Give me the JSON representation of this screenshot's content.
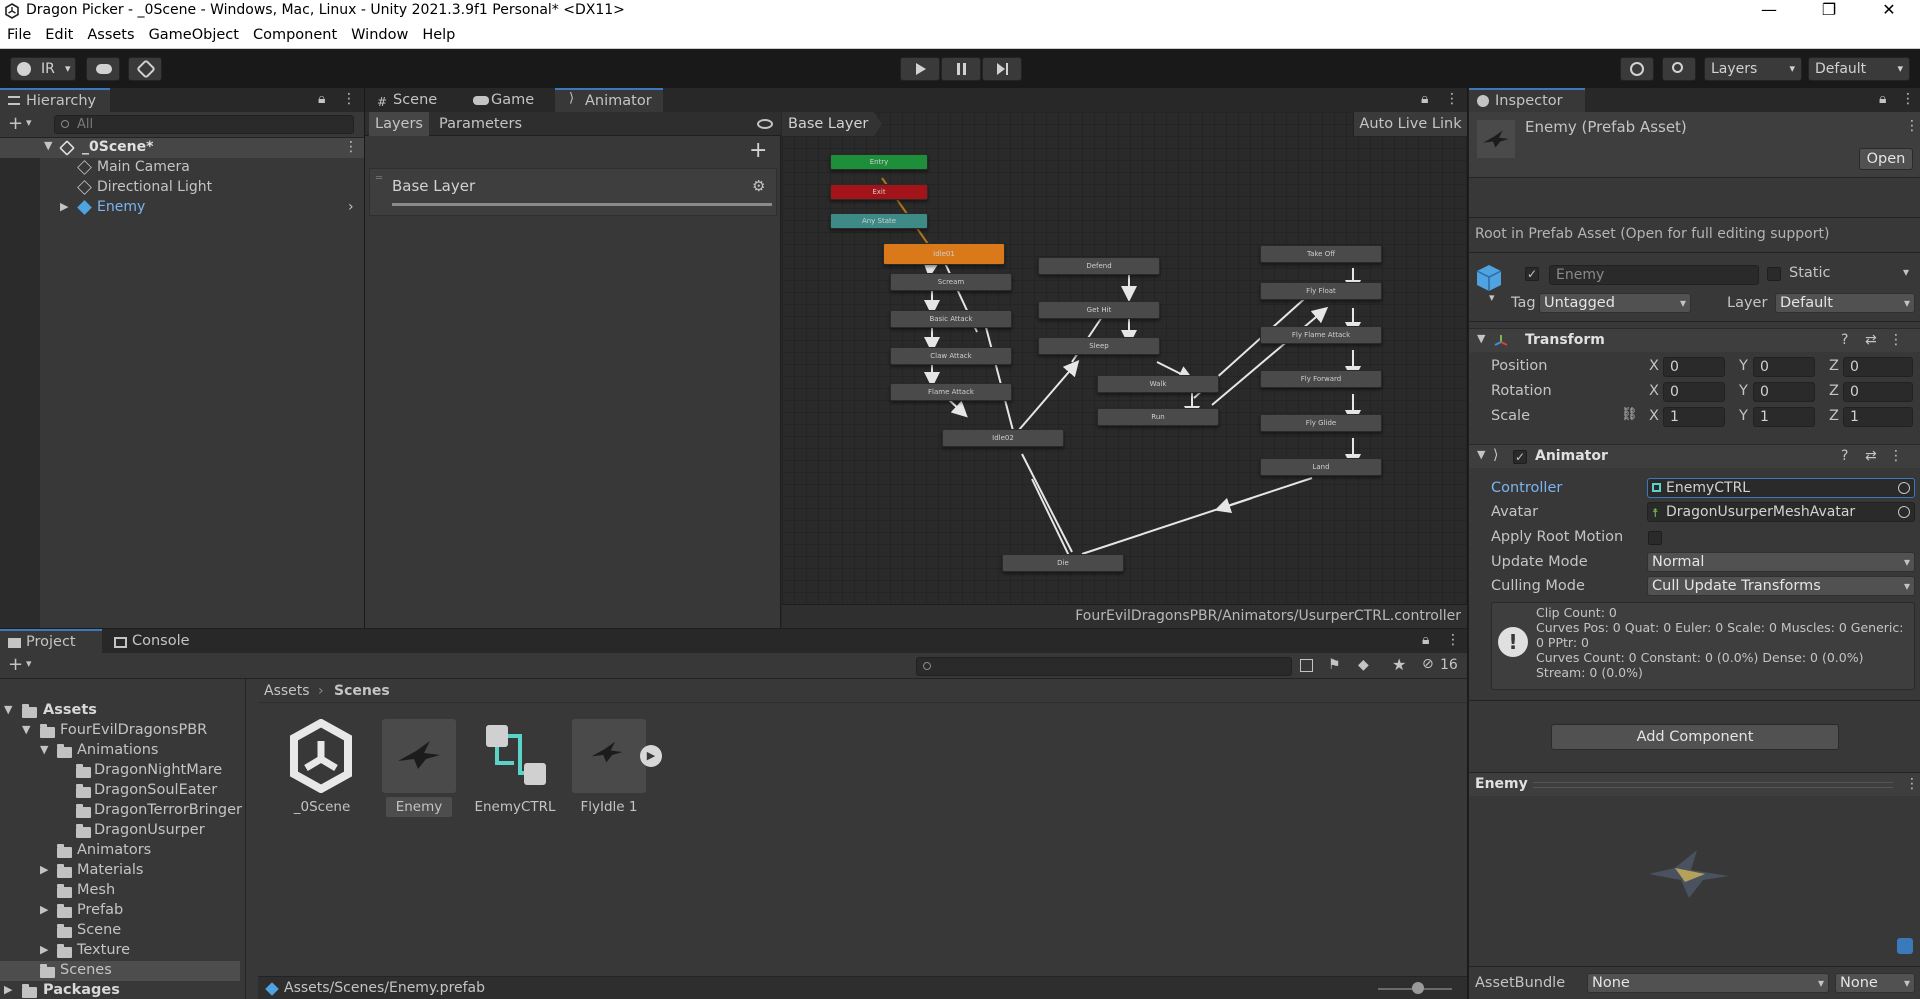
{
  "window": {
    "title": "Dragon Picker - _0Scene - Windows, Mac, Linux - Unity 2021.3.9f1 Personal* <DX11>",
    "minimize": "—",
    "maximize": "❐",
    "close": "✕"
  },
  "menu": [
    "File",
    "Edit",
    "Assets",
    "GameObject",
    "Component",
    "Window",
    "Help"
  ],
  "toolbar": {
    "account": "IR",
    "layers": "Layers",
    "layout": "Default"
  },
  "hierarchy": {
    "tab": "Hierarchy",
    "search_placeholder": "All",
    "scene": "_0Scene*",
    "items": [
      "Main Camera",
      "Directional Light",
      "Enemy"
    ]
  },
  "center_tabs": [
    "Scene",
    "Game",
    "Animator"
  ],
  "animator": {
    "subtabs": [
      "Layers",
      "Parameters"
    ],
    "layer": "Base Layer",
    "breadcrumb": "Base Layer",
    "auto_live_link": "Auto Live Link",
    "path": "FourEvilDragonsPBR/Animators/UsurperCTRL.controller",
    "states": {
      "entry": "Entry",
      "exit": "Exit",
      "any_state": "Any State",
      "idle01": "Idle01",
      "scream": "Scream",
      "basic_attack": "Basic Attack",
      "claw_attack": "Claw Attack",
      "flame_attack": "Flame Attack",
      "idle02": "Idle02",
      "defend": "Defend",
      "get_hit": "Get Hit",
      "sleep": "Sleep",
      "walk": "Walk",
      "run": "Run",
      "die": "Die",
      "take_off": "Take Off",
      "fly_float": "Fly Float",
      "fly_flame_attack": "Fly Flame Attack",
      "fly_forward": "Fly Forward",
      "fly_glide": "Fly Glide",
      "land": "Land"
    }
  },
  "project": {
    "tabs": [
      "Project",
      "Console"
    ],
    "tree": {
      "assets": "Assets",
      "fourevil": "FourEvilDragonsPBR",
      "animations": "Animations",
      "anim_children": [
        "DragonNightMare",
        "DragonSoulEater",
        "DragonTerrorBringer",
        "DragonUsurper"
      ],
      "others": [
        "Animators",
        "Materials",
        "Mesh",
        "Prefab",
        "Scene",
        "Texture"
      ],
      "scenes": "Scenes",
      "packages": "Packages"
    },
    "breadcrumb": [
      "Assets",
      "Scenes"
    ],
    "hidden_count": "16",
    "grid_items": [
      "_0Scene",
      "Enemy",
      "EnemyCTRL",
      "FlyIdle 1"
    ],
    "status_path": "Assets/Scenes/Enemy.prefab"
  },
  "inspector": {
    "tab": "Inspector",
    "asset_title": "Enemy (Prefab Asset)",
    "open_button": "Open",
    "note": "Root in Prefab Asset (Open for full editing support)",
    "name": "Enemy",
    "static_label": "Static",
    "tag_label": "Tag",
    "tag_value": "Untagged",
    "layer_label": "Layer",
    "layer_value": "Default",
    "transform": {
      "title": "Transform",
      "rows": [
        {
          "label": "Position",
          "x": "0",
          "y": "0",
          "z": "0"
        },
        {
          "label": "Rotation",
          "x": "0",
          "y": "0",
          "z": "0"
        },
        {
          "label": "Scale",
          "x": "1",
          "y": "1",
          "z": "1"
        }
      ],
      "axes": [
        "X",
        "Y",
        "Z"
      ]
    },
    "animator": {
      "title": "Animator",
      "controller_label": "Controller",
      "controller_value": "EnemyCTRL",
      "avatar_label": "Avatar",
      "avatar_value": "DragonUsurperMeshAvatar",
      "root_motion_label": "Apply Root Motion",
      "update_mode_label": "Update Mode",
      "update_mode_value": "Normal",
      "culling_mode_label": "Culling Mode",
      "culling_mode_value": "Cull Update Transforms",
      "info_lines": [
        "Clip Count: 0",
        "Curves Pos: 0 Quat: 0 Euler: 0 Scale: 0 Muscles: 0 Generic:",
        "0 PPtr: 0",
        "Curves Count: 0 Constant: 0 (0.0%) Dense: 0 (0.0%)",
        "Stream: 0 (0.0%)"
      ]
    },
    "add_component": "Add Component",
    "preview_title": "Enemy",
    "assetbundle_label": "AssetBundle",
    "assetbundle_value": "None",
    "assetbundle_variant": "None"
  }
}
